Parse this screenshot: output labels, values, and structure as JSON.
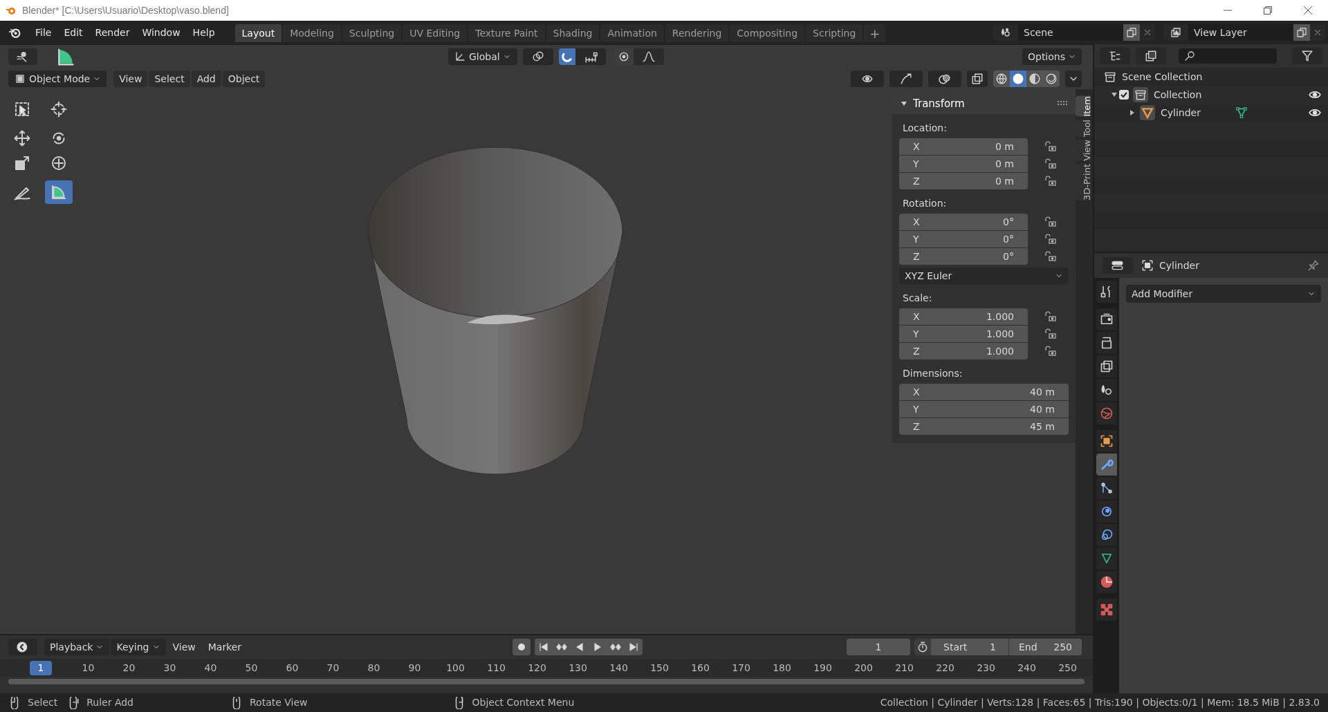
{
  "window": {
    "title": "Blender* [C:\\Users\\Usuario\\Desktop\\vaso.blend]"
  },
  "menu": [
    "File",
    "Edit",
    "Render",
    "Window",
    "Help"
  ],
  "workspaces": [
    {
      "label": "Layout",
      "selected": true
    },
    {
      "label": "Modeling",
      "selected": false
    },
    {
      "label": "Sculpting",
      "selected": false
    },
    {
      "label": "UV Editing",
      "selected": false
    },
    {
      "label": "Texture Paint",
      "selected": false
    },
    {
      "label": "Shading",
      "selected": false
    },
    {
      "label": "Animation",
      "selected": false
    },
    {
      "label": "Rendering",
      "selected": false
    },
    {
      "label": "Compositing",
      "selected": false
    },
    {
      "label": "Scripting",
      "selected": false
    }
  ],
  "add_workspace": "+",
  "scene": "Scene",
  "view_layer": "View Layer",
  "viewport": {
    "orientation": "Global",
    "snap_on": true,
    "options": "Options",
    "mode": "Object Mode",
    "menus": [
      "View",
      "Select",
      "Add",
      "Object"
    ],
    "shading": [
      {
        "kind": "wireframe",
        "selected": false
      },
      {
        "kind": "solid",
        "selected": true
      },
      {
        "kind": "material",
        "selected": false
      },
      {
        "kind": "rendered",
        "selected": false
      }
    ],
    "tools": [
      {
        "kind": "select-box",
        "selected": false
      },
      {
        "kind": "cursor",
        "selected": false
      },
      {
        "kind": "move",
        "selected": false
      },
      {
        "kind": "rotate",
        "selected": false
      },
      {
        "kind": "scale",
        "selected": false
      },
      {
        "kind": "transform",
        "selected": false
      },
      {
        "kind": "annotate",
        "selected": false
      },
      {
        "kind": "measure",
        "selected": true
      }
    ]
  },
  "sidebar": {
    "tabs": [
      {
        "label": "Item",
        "selected": true
      },
      {
        "label": "Tool",
        "selected": false
      },
      {
        "label": "View",
        "selected": false
      },
      {
        "label": "3D-Print",
        "selected": false
      }
    ],
    "panel_title": "Transform",
    "sections": [
      {
        "kind": "vector",
        "label": "Location:",
        "fields": [
          {
            "axis": "X",
            "value": "0 m",
            "locked": false
          },
          {
            "axis": "Y",
            "value": "0 m",
            "locked": false
          },
          {
            "axis": "Z",
            "value": "0 m",
            "locked": false
          }
        ]
      },
      {
        "kind": "vector",
        "label": "Rotation:",
        "fields": [
          {
            "axis": "X",
            "value": "0°",
            "locked": false
          },
          {
            "axis": "Y",
            "value": "0°",
            "locked": false
          },
          {
            "axis": "Z",
            "value": "0°",
            "locked": false
          }
        ]
      },
      {
        "kind": "dropdown",
        "value": "XYZ Euler"
      },
      {
        "kind": "vector",
        "label": "Scale:",
        "fields": [
          {
            "axis": "X",
            "value": "1.000",
            "locked": false
          },
          {
            "axis": "Y",
            "value": "1.000",
            "locked": false
          },
          {
            "axis": "Z",
            "value": "1.000",
            "locked": false
          }
        ]
      },
      {
        "kind": "vector",
        "label": "Dimensions:",
        "fields": [
          {
            "axis": "X",
            "value": "40 m"
          },
          {
            "axis": "Y",
            "value": "40 m"
          },
          {
            "axis": "Z",
            "value": "45 m"
          }
        ]
      }
    ]
  },
  "outliner": {
    "tree": [
      {
        "kind": "scene-collection",
        "label": "Scene Collection",
        "children": [
          {
            "kind": "collection",
            "label": "Collection",
            "checked": true,
            "visible": true,
            "expanded": true,
            "children": [
              {
                "kind": "mesh-object",
                "label": "Cylinder",
                "visible": true,
                "expanded": false
              }
            ]
          }
        ]
      }
    ]
  },
  "properties": {
    "object_name": "Cylinder",
    "add_modifier": "Add Modifier",
    "tabs": [
      {
        "kind": "tool",
        "selected": false
      },
      {
        "kind": "render",
        "selected": false
      },
      {
        "kind": "output",
        "selected": false
      },
      {
        "kind": "view-layer",
        "selected": false
      },
      {
        "kind": "scene",
        "selected": false
      },
      {
        "kind": "world",
        "selected": false
      },
      {
        "kind": "object",
        "selected": false
      },
      {
        "kind": "modifier",
        "selected": true
      },
      {
        "kind": "particles",
        "selected": false
      },
      {
        "kind": "physics",
        "selected": false
      },
      {
        "kind": "constraints",
        "selected": false
      },
      {
        "kind": "data",
        "selected": false
      },
      {
        "kind": "material",
        "selected": false
      },
      {
        "kind": "texture",
        "selected": false
      }
    ]
  },
  "timeline": {
    "menus": [
      {
        "label": "Playback",
        "dropdown": true
      },
      {
        "label": "Keying",
        "dropdown": true
      },
      {
        "label": "View",
        "dropdown": false
      },
      {
        "label": "Marker",
        "dropdown": false
      }
    ],
    "current_frame": "1",
    "start_label": "Start",
    "start": "1",
    "end_label": "End",
    "end": "250",
    "frames": [
      {
        "label": "1",
        "selected": true
      },
      {
        "label": "10",
        "selected": false
      },
      {
        "label": "20",
        "selected": false
      },
      {
        "label": "30",
        "selected": false
      },
      {
        "label": "40",
        "selected": false
      },
      {
        "label": "50",
        "selected": false
      },
      {
        "label": "60",
        "selected": false
      },
      {
        "label": "70",
        "selected": false
      },
      {
        "label": "80",
        "selected": false
      },
      {
        "label": "90",
        "selected": false
      },
      {
        "label": "100",
        "selected": false
      },
      {
        "label": "110",
        "selected": false
      },
      {
        "label": "120",
        "selected": false
      },
      {
        "label": "130",
        "selected": false
      },
      {
        "label": "140",
        "selected": false
      },
      {
        "label": "150",
        "selected": false
      },
      {
        "label": "160",
        "selected": false
      },
      {
        "label": "170",
        "selected": false
      },
      {
        "label": "180",
        "selected": false
      },
      {
        "label": "190",
        "selected": false
      },
      {
        "label": "200",
        "selected": false
      },
      {
        "label": "210",
        "selected": false
      },
      {
        "label": "220",
        "selected": false
      },
      {
        "label": "230",
        "selected": false
      },
      {
        "label": "240",
        "selected": false
      },
      {
        "label": "250",
        "selected": false
      }
    ]
  },
  "status_bar": {
    "hints": [
      {
        "label": "Select"
      },
      {
        "label": "Ruler Add"
      },
      {
        "label": "Rotate View"
      },
      {
        "label": "Object Context Menu"
      }
    ],
    "stats": "Collection | Cylinder | Verts:128 | Faces:65 | Tris:190 | Objects:0/1 | Mem: 18.5 MiB | 2.83.0"
  }
}
